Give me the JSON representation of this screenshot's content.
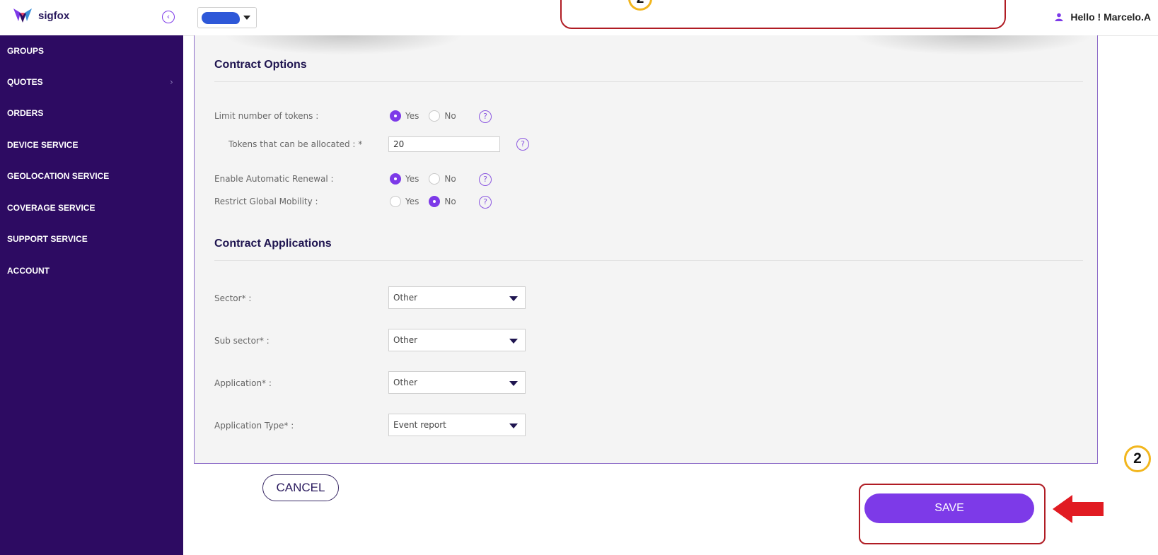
{
  "header": {
    "logo_text": "sigfox",
    "collapse_icon": "chevron-left-circle-icon",
    "user_icon": "user-icon",
    "greeting": "Hello ! Marcelo.A"
  },
  "sidebar": {
    "items": [
      {
        "label": "GROUPS"
      },
      {
        "label": "QUOTES",
        "has_submenu": true
      },
      {
        "label": "ORDERS"
      },
      {
        "label": "DEVICE SERVICE"
      },
      {
        "label": "GEOLOCATION SERVICE"
      },
      {
        "label": "COVERAGE SERVICE"
      },
      {
        "label": "SUPPORT SERVICE"
      },
      {
        "label": "ACCOUNT"
      }
    ]
  },
  "contract_options": {
    "title": "Contract Options",
    "limit_tokens": {
      "label": "Limit number of tokens :",
      "selected": "Yes"
    },
    "tokens_allocated": {
      "label": "Tokens that can be allocated : *",
      "value": "20"
    },
    "auto_renewal": {
      "label": "Enable Automatic Renewal :",
      "selected": "Yes"
    },
    "global_mobility": {
      "label": "Restrict Global Mobility :",
      "selected": "No"
    },
    "yes_label": "Yes",
    "no_label": "No",
    "help_glyph": "?"
  },
  "contract_applications": {
    "title": "Contract Applications",
    "sector": {
      "label": "Sector* :",
      "value": "Other"
    },
    "sub_sector": {
      "label": "Sub sector* :",
      "value": "Other"
    },
    "application": {
      "label": "Application* :",
      "value": "Other"
    },
    "application_type": {
      "label": "Application Type* :",
      "value": "Event report"
    }
  },
  "footer": {
    "cancel_label": "CANCEL",
    "save_label": "SAVE"
  },
  "annotations": {
    "step_number": "2",
    "highlight_color": "#b01c24",
    "badge_color": "#f2b61e"
  },
  "colors": {
    "sidebar_bg": "#2d0b62",
    "accent": "#7d3ae8",
    "title": "#1f1550"
  }
}
